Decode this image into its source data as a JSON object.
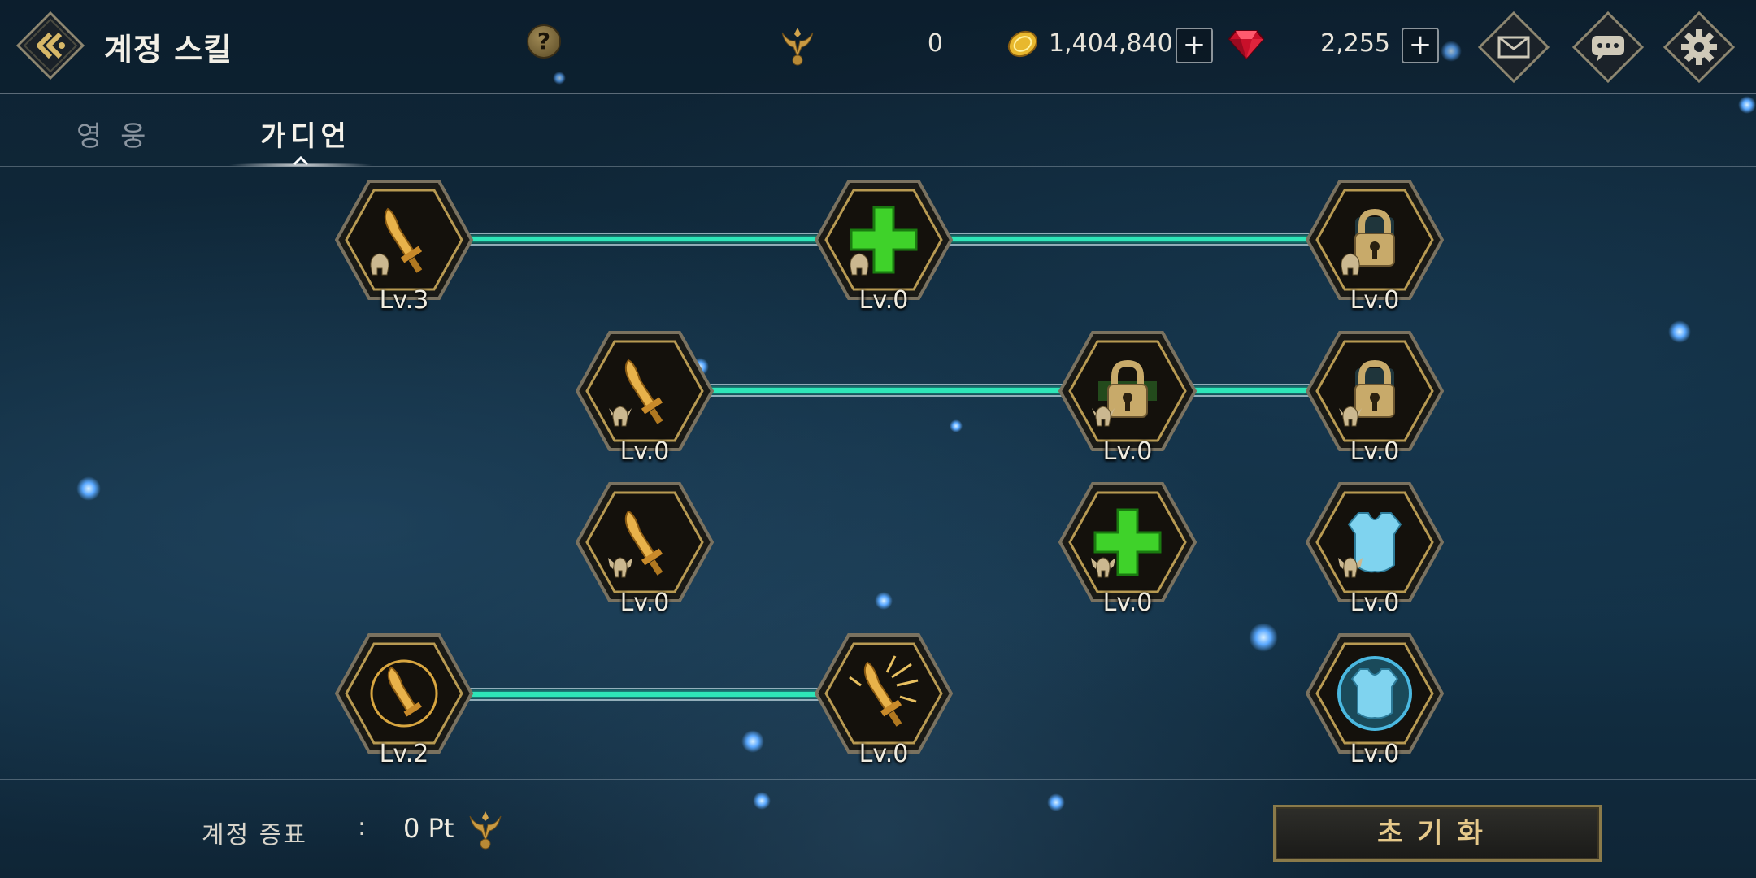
{
  "header": {
    "title": "계정 스킬",
    "help_symbol": "?",
    "emblem_count": "0",
    "gold": "1,404,840",
    "gems": "2,255",
    "plus_symbol": "+"
  },
  "tabs": [
    {
      "label": "영 웅",
      "active": false
    },
    {
      "label": "가디언",
      "active": true
    }
  ],
  "skill_tree": {
    "nodes": [
      {
        "name": "sword-skill-r1c1",
        "icon": "sword-icon",
        "level": "Lv.3",
        "state": "unlocked"
      },
      {
        "name": "heal-skill-r1c2",
        "icon": "plus-icon",
        "level": "Lv.0",
        "state": "unlocked"
      },
      {
        "name": "locked-skill-r1c3",
        "icon": "lock-icon",
        "level": "Lv.0",
        "state": "locked"
      },
      {
        "name": "sword-skill-r2c1",
        "icon": "sword-icon",
        "level": "Lv.0",
        "state": "unlocked"
      },
      {
        "name": "locked-skill-r2c2",
        "icon": "lock-icon",
        "level": "Lv.0",
        "state": "locked"
      },
      {
        "name": "locked-skill-r2c3",
        "icon": "lock-icon",
        "level": "Lv.0",
        "state": "locked"
      },
      {
        "name": "sword-skill-r3c1",
        "icon": "sword-icon",
        "level": "Lv.0",
        "state": "unlocked"
      },
      {
        "name": "heal-skill-r3c2",
        "icon": "plus-icon",
        "level": "Lv.0",
        "state": "unlocked"
      },
      {
        "name": "armor-skill-r3c3",
        "icon": "armor-icon",
        "level": "Lv.0",
        "state": "unlocked"
      },
      {
        "name": "sword-ring-skill-r4c1",
        "icon": "sword-ring-icon",
        "level": "Lv.2",
        "state": "unlocked"
      },
      {
        "name": "sword-burst-skill-r4c2",
        "icon": "sword-burst-icon",
        "level": "Lv.0",
        "state": "unlocked"
      },
      {
        "name": "armor-ring-skill-r4c3",
        "icon": "armor-ring-icon",
        "level": "Lv.0",
        "state": "unlocked"
      }
    ]
  },
  "footer": {
    "label": "계정 증표",
    "colon": ":",
    "points": "0 Pt",
    "reset_label": "초기화"
  },
  "colors": {
    "connector": "#2ee6b8",
    "gold": "#e6b24a",
    "heal_green": "#3fd22a",
    "armor_blue": "#7fd3ef",
    "lock": "#c8aa6a"
  }
}
